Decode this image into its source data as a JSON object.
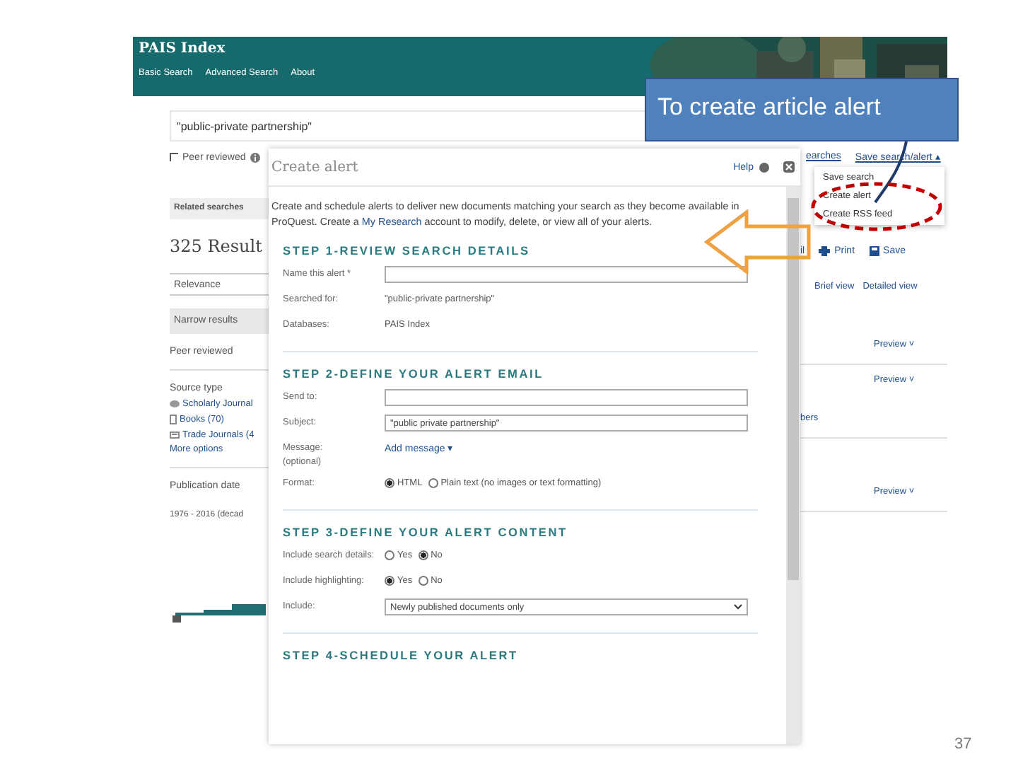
{
  "slide_number": "37",
  "callout": "To create article alert",
  "header": {
    "title": "PAIS Index",
    "nav": [
      {
        "label": "Basic Search"
      },
      {
        "label": "Advanced Search"
      },
      {
        "label": "About"
      }
    ]
  },
  "search": {
    "value": "\"public-private partnership\""
  },
  "peer_reviewed": {
    "label": "Peer reviewed",
    "checked": false
  },
  "top_links": {
    "searches": "earches",
    "save_menu": "Save search/alert ▴",
    "menu_items": [
      "Save search",
      "Create alert",
      "Create RSS feed"
    ]
  },
  "related_searches": "Related searches",
  "results_count": "325 Result",
  "sort": {
    "value": "Relevance"
  },
  "sidebar": {
    "heading": "Narrow results",
    "peer_reviewed": "Peer reviewed",
    "source_type": {
      "title": "Source type",
      "items": [
        {
          "label": "Scholarly Journal",
          "kind": "journal"
        },
        {
          "label": "Books (70)",
          "kind": "book"
        },
        {
          "label": "Trade Journals (4",
          "kind": "trade"
        }
      ],
      "more": "More options"
    },
    "publication_date": {
      "title": "Publication date",
      "range": "1976 - 2016 (decad"
    }
  },
  "toolbar": [
    {
      "label": "il",
      "kind": "text"
    },
    {
      "label": "Print",
      "kind": "print"
    },
    {
      "label": "Save",
      "kind": "save"
    }
  ],
  "views": [
    "Brief view",
    "Detailed view"
  ],
  "results": [
    {
      "preview": "Preview ˅"
    },
    {
      "preview": "Preview ˅",
      "snippet": "bers"
    },
    {
      "preview": "Preview ˅"
    }
  ],
  "modal": {
    "title": "Create alert",
    "help": "Help",
    "intro": {
      "before": "Create and schedule alerts to deliver new documents matching your search as they become available in ProQuest. Create a ",
      "link": "My Research",
      "after": " account to modify, delete, or view all of your alerts."
    },
    "steps": [
      {
        "heading": "STEP 1-REVIEW SEARCH DETAILS",
        "rows": [
          {
            "kind": "input",
            "label": "Name this alert *"
          },
          {
            "kind": "static",
            "label": "Searched for:",
            "value": "\"public-private partnership\""
          },
          {
            "kind": "static",
            "label": "Databases:",
            "value": "PAIS Index"
          }
        ]
      },
      {
        "heading": "STEP 2-DEFINE YOUR ALERT EMAIL",
        "rows": [
          {
            "kind": "input",
            "label": "Send to:"
          },
          {
            "kind": "input",
            "label": "Subject:",
            "value": "\"public private partnership\""
          },
          {
            "kind": "link",
            "label": "Message:",
            "sublabel": "(optional)",
            "value": "Add message ▾"
          },
          {
            "kind": "radio",
            "label": "Format:",
            "options": [
              {
                "label": "HTML",
                "selected": true
              },
              {
                "label": "Plain text (no images or text formatting)",
                "selected": false
              }
            ]
          }
        ]
      },
      {
        "heading": "STEP 3-DEFINE YOUR ALERT CONTENT",
        "rows": [
          {
            "kind": "radio",
            "label": "Include search details:",
            "options": [
              {
                "label": "Yes",
                "selected": false
              },
              {
                "label": "No",
                "selected": true
              }
            ]
          },
          {
            "kind": "radio",
            "label": "Include highlighting:",
            "options": [
              {
                "label": "Yes",
                "selected": true
              },
              {
                "label": "No",
                "selected": false
              }
            ]
          },
          {
            "kind": "select",
            "label": "Include:",
            "value": "Newly published documents only"
          }
        ]
      },
      {
        "heading": "STEP 4-SCHEDULE YOUR ALERT"
      }
    ]
  }
}
